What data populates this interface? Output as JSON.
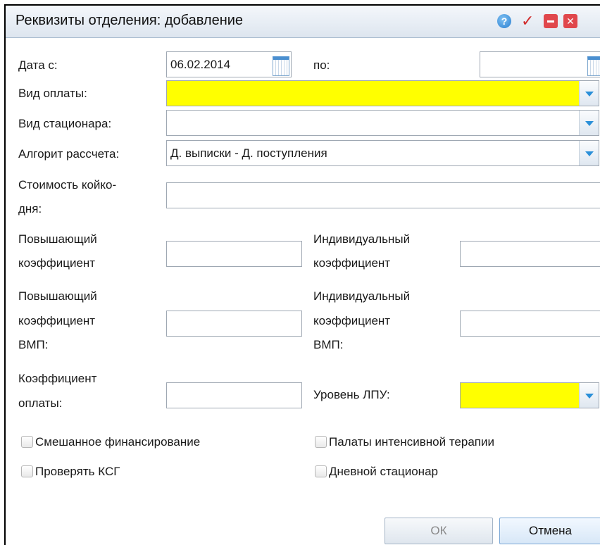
{
  "window": {
    "title": "Реквизиты отделения: добавление"
  },
  "form": {
    "date_from_label": "Дата с:",
    "date_from_value": "06.02.2014",
    "date_to_label": "по:",
    "date_to_value": "",
    "payment_type_label": "Вид оплаты:",
    "payment_type_value": "",
    "hospital_type_label": "Вид стационара:",
    "hospital_type_value": "",
    "algorithm_label": "Алгорит рассчета:",
    "algorithm_value": "Д. выписки - Д. поступления",
    "bed_day_cost_label_1": "Стоимость койко-",
    "bed_day_cost_label_2": "дня:",
    "raising_coef_label_1": "Повышающий",
    "raising_coef_label_2": "коэффициент",
    "individual_coef_label_1": "Индивидуальный",
    "individual_coef_label_2": "коэффициент",
    "raising_coef_vmp_label_1": "Повышающий",
    "raising_coef_vmp_label_2": "коэффициент",
    "raising_coef_vmp_label_3": "ВМП:",
    "individual_coef_vmp_label_1": "Индивидуальный",
    "individual_coef_vmp_label_2": "коэффициент",
    "individual_coef_vmp_label_3": "ВМП:",
    "payment_coef_label_1": "Коэффициент",
    "payment_coef_label_2": "оплаты:",
    "lpu_level_label": "Уровень ЛПУ:",
    "mixed_financing_label": "Смешанное финансирование",
    "intensive_care_label": "Палаты интенсивной терапии",
    "check_ksg_label": "Проверять КСГ",
    "day_hospital_label": "Дневной стационар"
  },
  "buttons": {
    "ok": "ОК",
    "cancel": "Отмена"
  },
  "colors": {
    "required_field": "#ffff00",
    "accent": "#2a8fd8"
  }
}
